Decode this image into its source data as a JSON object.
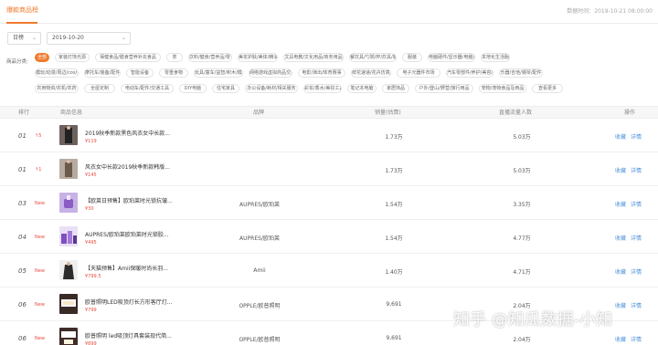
{
  "header": {
    "active_tab": "爆款商品榜",
    "updated_label": "数据时间：2019-10-21 08:00:00"
  },
  "filters": {
    "period_type": "日榜",
    "date": "2019-10-20"
  },
  "categories": {
    "label": "商品分类:",
    "items": [
      "全部",
      "家装灯饰光源",
      "保健食品/膳食营养补充食品",
      "茶",
      "饮料/健食/营养品/零食",
      "美妆护肤/美体/精油",
      "文具电教/文化用品/商务用品",
      "餐饮具/勺粥/杯/炊具/瓶",
      "服装",
      "电脑硬件/显示器/电脑周边",
      "本地化生活服务",
      "模玩/动漫/周边/cos/桌游",
      "摩托车/装备/配件",
      "智能设备",
      "零重食物",
      "玩具/童车/益智/积木/模型",
      "网络游戏虚拟商品交易平台",
      "电影/演出/体育赛事",
      "鲜花速递/花卉仿真/绿植园艺",
      "电子元器件市场",
      "汽车零部件/养护/美容/维保",
      "乐器/吉他/钢琴/配件",
      "农用物资/农机/农药",
      "全屋定制",
      "电动车/配件/交通工具",
      "DIY电脑",
      "住宅家具",
      "办公设备/耗材/相关服务",
      "彩妆/香水/美妆工具",
      "笔记本电脑",
      "家居饰品",
      "户外/登山/野营/旅行用品",
      "宠物/宠物食品及用品",
      "查看更多"
    ]
  },
  "table": {
    "columns": [
      "排行",
      "商品信息",
      "品牌",
      "销量(估算)",
      "直播流量人数",
      "操作"
    ],
    "actions": [
      "收藏",
      "详情"
    ],
    "rows": [
      {
        "rank": "01",
        "change": "↑5",
        "name": "2019秋季新款黑色风衣女中长款...",
        "price": "¥119",
        "brand": "",
        "sales": "1.73万",
        "buyers": "5.03万",
        "thumb": "coat-dark"
      },
      {
        "rank": "01",
        "change": "↑1",
        "name": "风衣女中长款2019秋季新款韩版...",
        "price": "¥145",
        "brand": "",
        "sales": "1.73万",
        "buyers": "5.03万",
        "thumb": "coat-brown"
      },
      {
        "rank": "03",
        "change": "New",
        "name": "【欧莱日预售】欧珀莱时光锁抗皱...",
        "price": "¥30",
        "brand": "AUPRES/欧珀莱",
        "sales": "1.54万",
        "buyers": "3.35万",
        "thumb": "cosmetic-purple"
      },
      {
        "rank": "04",
        "change": "New",
        "name": "AUPRES/欧珀莱欧珀莱时光锁胶...",
        "price": "¥495",
        "brand": "AUPRES/欧珀莱",
        "sales": "1.54万",
        "buyers": "4.77万",
        "thumb": "cosmetic-set"
      },
      {
        "rank": "05",
        "change": "New",
        "name": "【天猫预售】Amii保暖时尚长羽...",
        "price": "¥799.5",
        "brand": "Amii",
        "sales": "1.40万",
        "buyers": "4.71万",
        "thumb": "down-coat"
      },
      {
        "rank": "06",
        "change": "New",
        "name": "欧普照明LED吸顶灯长方形客厅灯...",
        "price": "¥799",
        "brand": "OPPLE/欧普照明",
        "sales": "9,691",
        "buyers": "2.04万",
        "thumb": "ceiling-lamp"
      },
      {
        "rank": "06",
        "change": "New",
        "name": "欧普照明 led吸顶灯具套装现代简...",
        "price": "¥899",
        "brand": "OPPLE/欧普照明",
        "sales": "9,691",
        "buyers": "2.04万",
        "thumb": "ceiling-lamp-set"
      }
    ]
  },
  "watermark": "知乎 @知瓜数据-小知",
  "colors": {
    "accent": "#f07a2c",
    "price": "#e84c3d",
    "link": "#4a90d9"
  }
}
